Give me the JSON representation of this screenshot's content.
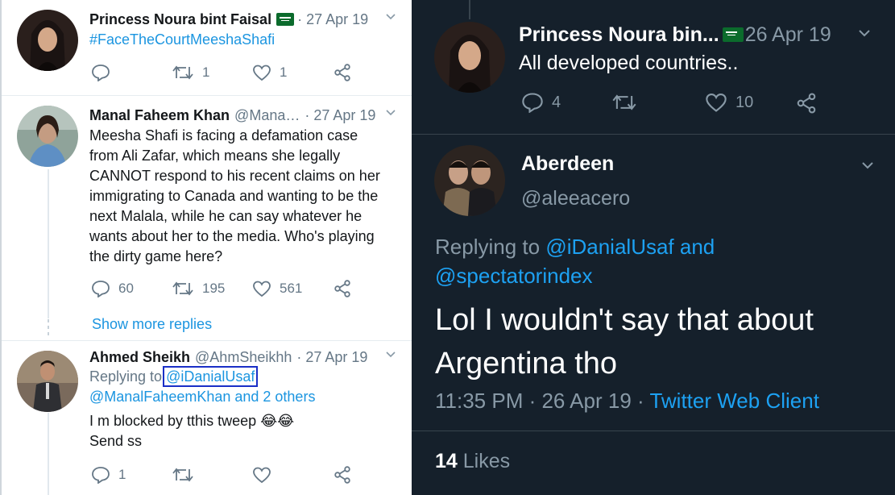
{
  "left_panel": {
    "tweet1": {
      "name": "Princess Noura bint Faisal",
      "date": "· 27 Apr 19",
      "text": "#FaceTheCourtMeeshaShafi",
      "reply_count": "",
      "retweet_count": "1",
      "like_count": "1"
    },
    "tweet2": {
      "name": "Manal Faheem Khan",
      "handle": "@Mana…",
      "date": "· 27 Apr 19",
      "lines": [
        "Meesha Shafi is facing a defamation case",
        "from Ali Zafar, which means she legally",
        "CANNOT respond to his recent claims on her",
        "immigrating to Canada and wanting to be the",
        "next Malala, while he can say whatever he",
        "wants about her to the media. Who's playing",
        "the dirty game here?"
      ],
      "reply_count": "60",
      "retweet_count": "195",
      "like_count": "561"
    },
    "show_more": "Show more replies",
    "tweet3": {
      "name": "Ahmed Sheikh",
      "handle": "@AhmSheikhh",
      "date": "· 27 Apr 19",
      "replying_prefix": "Replying to",
      "replying_to_1": "@iDanialUsaf",
      "replying_to_2": "@ManalFaheemKhan and 2 others",
      "text_line1": "I m blocked by tthis tweep 😂😂",
      "text_line2": "Send ss",
      "reply_count": "1",
      "retweet_count": "",
      "like_count": ""
    }
  },
  "right_panel": {
    "tweet1": {
      "name": "Princess Noura bin...",
      "date": "26 Apr 19",
      "text": "All developed countries..",
      "reply_count": "4",
      "retweet_count": "",
      "like_count": "10"
    },
    "tweet2": {
      "name": "Aberdeen",
      "handle": "@aleeacero",
      "replying_prefix": "Replying to",
      "replying_to_1": "@iDanialUsaf",
      "replying_and": "and",
      "replying_to_2": "@spectatorindex",
      "text_line1": "Lol I wouldn't say that about",
      "text_line2": "Argentina tho",
      "time": "11:35 PM · 26 Apr 19 ·",
      "client": "Twitter Web Client",
      "likes_count": "14",
      "likes_label": "Likes"
    }
  },
  "colors": {
    "link_light": "#1b95e0",
    "link_dark": "#1da1f2",
    "dark_bg": "#15202b",
    "highlight_box": "#1a2fc7"
  },
  "icons": [
    "reply-icon",
    "retweet-icon",
    "like-icon",
    "share-icon",
    "chevron-down-icon",
    "saudi-flag-icon"
  ]
}
